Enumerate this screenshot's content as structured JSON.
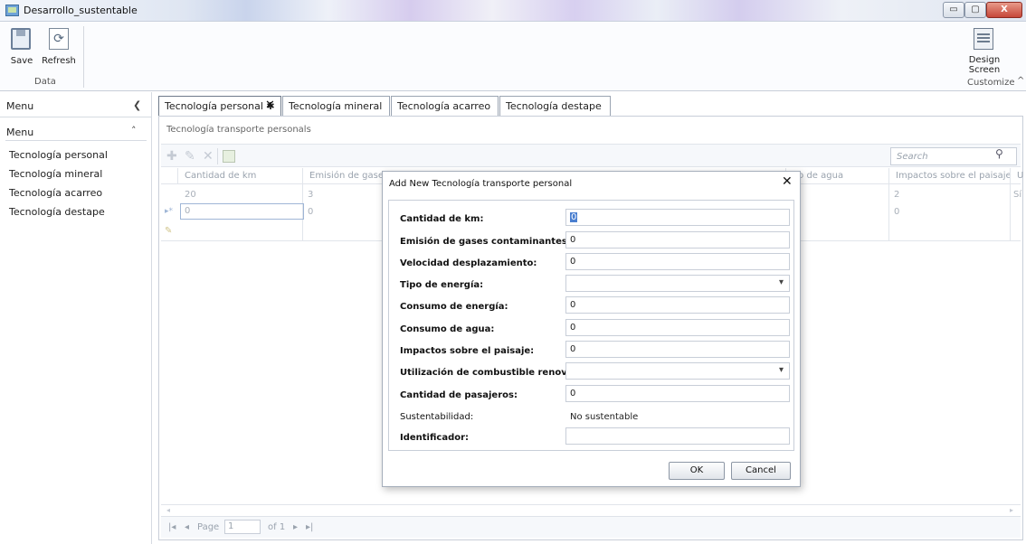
{
  "window": {
    "title": "Desarrollo_sustentable",
    "minimize": "▭",
    "maximize": "▢",
    "close": "X"
  },
  "ribbon": {
    "save_label": "Save",
    "refresh_label": "Refresh",
    "data_group": "Data",
    "design_line1": "Design",
    "design_line2": "Screen",
    "customize_group": "Customize",
    "collapse": "^"
  },
  "sidebar": {
    "header": "Menu",
    "group": "Menu",
    "items": [
      {
        "label": "Tecnología personal"
      },
      {
        "label": "Tecnología mineral"
      },
      {
        "label": "Tecnología acarreo"
      },
      {
        "label": "Tecnología destape"
      }
    ]
  },
  "tabs": [
    {
      "label": "Tecnología personal ✱",
      "active": true
    },
    {
      "label": "Tecnología mineral"
    },
    {
      "label": "Tecnología acarreo"
    },
    {
      "label": "Tecnología destape"
    }
  ],
  "content": {
    "title": "Tecnología transporte personals",
    "search_placeholder": "Search"
  },
  "grid": {
    "columns": [
      "Cantidad de km",
      "Emisión de gases co",
      "eo de agua",
      "Impactos sobre el paisaje",
      "U"
    ],
    "rows": [
      [
        "20",
        "3",
        "2",
        "Sí"
      ],
      [
        "0",
        "0",
        "0"
      ]
    ]
  },
  "pager": {
    "page_label": "Page",
    "page_value": "1",
    "of_label": "of 1"
  },
  "modal": {
    "title": "Add New Tecnología transporte personal",
    "fields": [
      {
        "label": "Cantidad de km:",
        "value": "0"
      },
      {
        "label": "Emisión de gases contaminantes:",
        "value": "0"
      },
      {
        "label": "Velocidad desplazamiento:",
        "value": "0"
      },
      {
        "label": "Tipo de energía:",
        "value": ""
      },
      {
        "label": "Consumo de energía:",
        "value": "0"
      },
      {
        "label": "Consumo de agua:",
        "value": "0"
      },
      {
        "label": "Impactos sobre el paisaje:",
        "value": "0"
      },
      {
        "label": "Utilización de combustible renovable:",
        "value": ""
      },
      {
        "label": "Cantidad de pasajeros:",
        "value": "0"
      },
      {
        "label": "Sustentabilidad:",
        "value": "No sustentable"
      },
      {
        "label": "Identificador:",
        "value": ""
      }
    ],
    "ok_label": "OK",
    "cancel_label": "Cancel"
  },
  "icons": {
    "save": "save-icon",
    "refresh": "refresh-icon",
    "design": "design-screen-icon",
    "add": "add-icon",
    "edit": "edit-icon",
    "delete": "delete-icon",
    "export": "export-excel-icon",
    "search": "search-icon",
    "close": "close-icon"
  },
  "colors": {
    "accent": "#4a7fd0",
    "close": "#c6473a"
  }
}
